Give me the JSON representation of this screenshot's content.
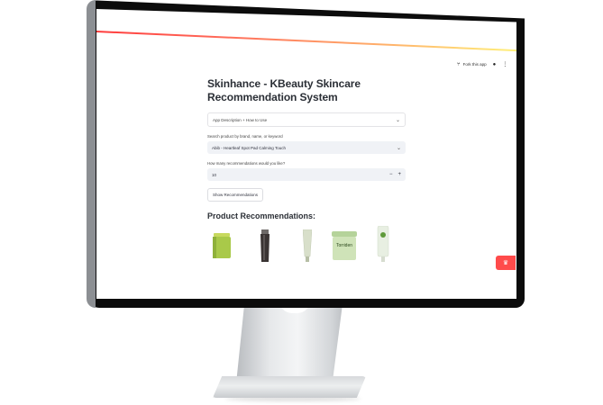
{
  "header": {
    "fork_label": "Fork this app",
    "github_icon": "github-icon",
    "menu_icon": "kebab-menu-icon"
  },
  "app": {
    "title": "Skinhance - KBeauty Skincare Recommendation System",
    "expander_label": "App Description + How to Use",
    "search": {
      "label": "Search product by brand, name, or keyword",
      "value": "Abib - Heartleaf Spot Pad Calming Touch"
    },
    "count": {
      "label": "How many recommendations would you like?",
      "value": "10",
      "minus": "−",
      "plus": "+"
    },
    "button_label": "Show Recommendations",
    "recommendations_title": "Product Recommendations:",
    "products": [
      {
        "name": "green-jar-product",
        "color": "#a9c949"
      },
      {
        "name": "dark-tube-product",
        "color": "#3a3433"
      },
      {
        "name": "sage-tube-product",
        "color": "#d8dfca"
      },
      {
        "name": "torriden-jar-product",
        "color": "#cfe3b8",
        "label": "Torriden"
      },
      {
        "name": "green-tube-product",
        "color": "#e8efe2"
      }
    ]
  },
  "colors": {
    "accent": "#ff4b4b",
    "select_bg": "#f0f2f6",
    "text": "#31333f"
  }
}
